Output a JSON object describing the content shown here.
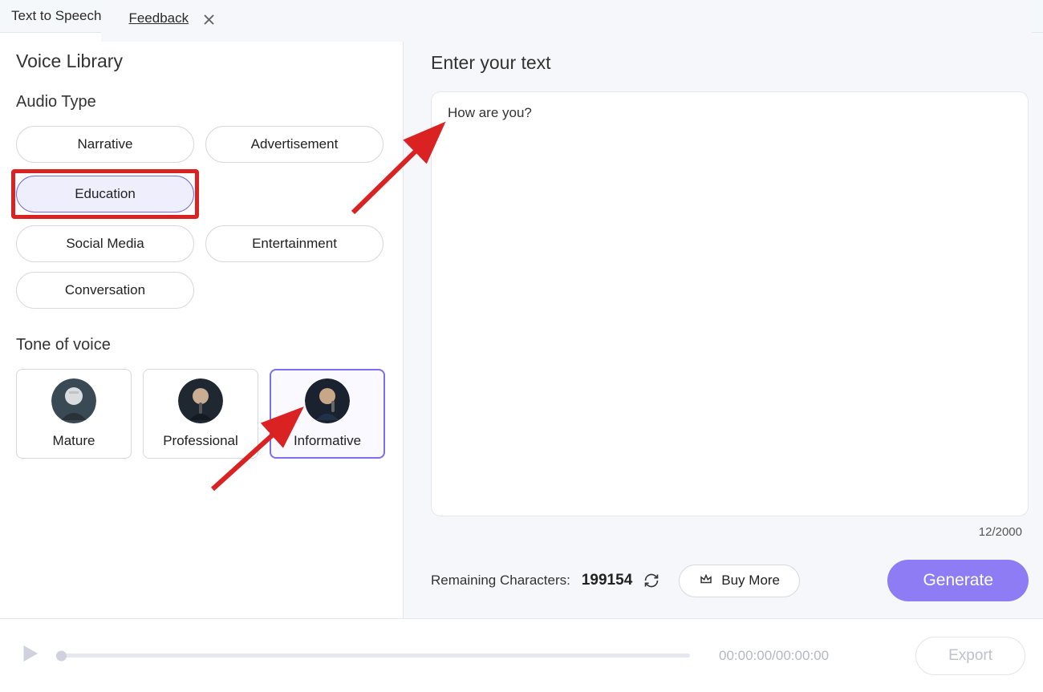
{
  "topbar": {
    "title": "Text to Speech",
    "feedback": "Feedback"
  },
  "library": {
    "title": "Voice Library",
    "audioTypeTitle": "Audio Type",
    "audioTypes": {
      "narrative": "Narrative",
      "advertisement": "Advertisement",
      "education": "Education",
      "socialMedia": "Social Media",
      "entertainment": "Entertainment",
      "conversation": "Conversation"
    },
    "toneTitle": "Tone of voice",
    "tones": {
      "mature": "Mature",
      "professional": "Professional",
      "informative": "Informative"
    }
  },
  "editor": {
    "title": "Enter your text",
    "text": "How are you?",
    "charCounter": "12/2000",
    "remainingLabel": "Remaining Characters:",
    "remainingCount": "199154",
    "buyMore": "Buy More",
    "generate": "Generate"
  },
  "player": {
    "timecode": "00:00:00/00:00:00",
    "export": "Export"
  }
}
